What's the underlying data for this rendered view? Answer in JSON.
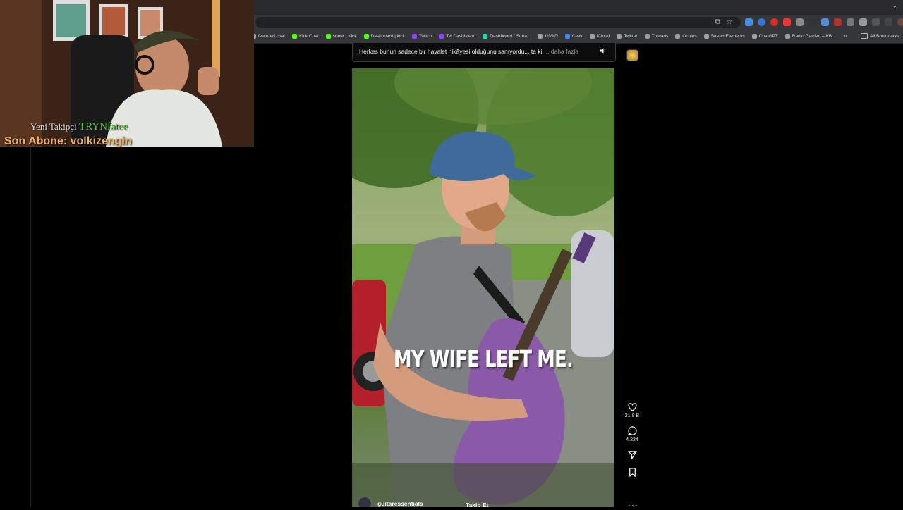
{
  "bookmarks": [
    {
      "label": "featured.chat",
      "color": "#9aa0a6"
    },
    {
      "label": "Kick Chat",
      "color": "#53fc18"
    },
    {
      "label": "soner | Kick",
      "color": "#53fc18"
    },
    {
      "label": "Dashboard | kick",
      "color": "#53fc18"
    },
    {
      "label": "Twitch",
      "color": "#9146ff"
    },
    {
      "label": "Tw Dashboard",
      "color": "#9146ff"
    },
    {
      "label": "Dashboard / Strea...",
      "color": "#2fd3b0"
    },
    {
      "label": "LIVAD",
      "color": "#9aa0a6"
    },
    {
      "label": "Çevir",
      "color": "#4285f4"
    },
    {
      "label": "iCloud",
      "color": "#9aa0a6"
    },
    {
      "label": "Twitter",
      "color": "#9aa0a6"
    },
    {
      "label": "Threads",
      "color": "#9aa0a6"
    },
    {
      "label": "Oculus",
      "color": "#9aa0a6"
    },
    {
      "label": "StreamElements",
      "color": "#9aa0a6"
    },
    {
      "label": "ChatGPT",
      "color": "#9aa0a6"
    },
    {
      "label": "Radio Garden – KB...",
      "color": "#9aa0a6"
    }
  ],
  "bookmarks_more": "»",
  "all_bookmarks": "All Bookmarks",
  "post": {
    "caption": "Herkes bunun sadece bir hayalet hikâyesi olduğunu sanıyordu... ta ki",
    "caption_more": "... daha fazla",
    "subtitle": "MY WIFE LEFT ME.",
    "account": "guitaressentials",
    "follow": "Takip Et"
  },
  "actions": {
    "likes": "21,8 B",
    "comments": "4.224"
  },
  "overlay": {
    "follower_label": "Yeni Takipçi",
    "follower_name": "TRYNfatee",
    "subscriber_text": "Son Abone: volkizengin"
  }
}
